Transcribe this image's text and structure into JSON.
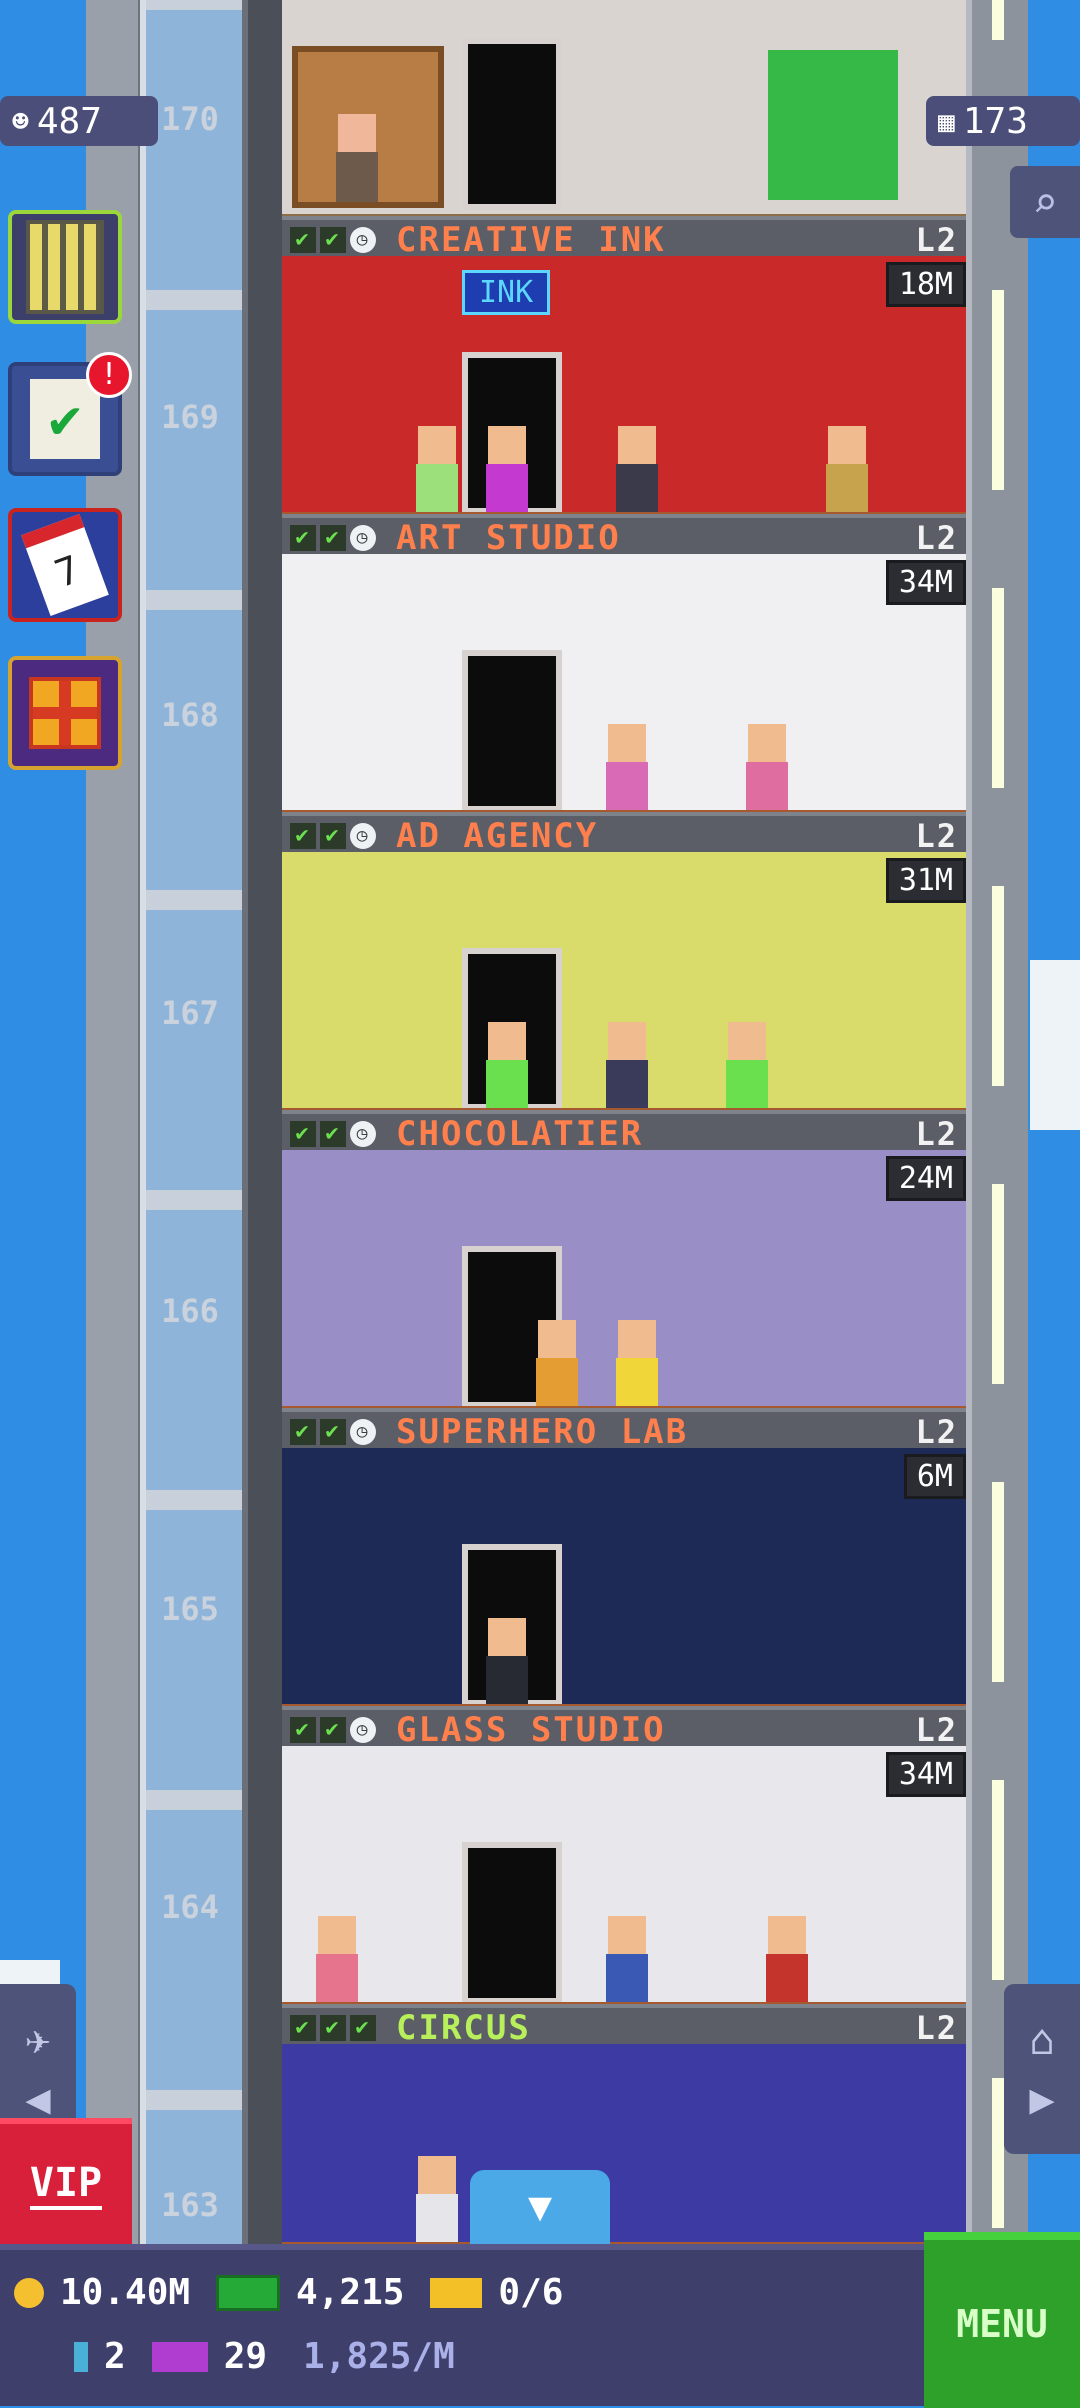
{
  "top_left_pill": {
    "icon": "person-icon",
    "value": "487"
  },
  "top_right_pill": {
    "icon": "building-icon",
    "value": "173"
  },
  "floor_numbers": [
    "170",
    "169",
    "168",
    "167",
    "166",
    "165",
    "164",
    "163"
  ],
  "floors": [
    {
      "name": "CREATIVE INK",
      "level": "L2",
      "timer": "18M",
      "sign": "INK",
      "wall": "#c92929"
    },
    {
      "name": "ART STUDIO",
      "level": "L2",
      "timer": "34M",
      "wall": "#f0f0f2"
    },
    {
      "name": "AD AGENCY",
      "level": "L2",
      "timer": "31M",
      "wall": "#d9dc6b"
    },
    {
      "name": "CHOCOLATIER",
      "level": "L2",
      "timer": "24M",
      "wall": "#9a8ec7"
    },
    {
      "name": "SUPERHERO LAB",
      "level": "L2",
      "timer": "6M",
      "wall": "#1c2a55"
    },
    {
      "name": "GLASS STUDIO",
      "level": "L2",
      "timer": "34M",
      "wall": "#e8e8ec"
    },
    {
      "name": "CIRCUS",
      "level": "L2",
      "timer": "",
      "wall": "#3d3aa3"
    }
  ],
  "side_buttons": [
    {
      "icon": "tower-icon"
    },
    {
      "icon": "checklist-icon",
      "badge": "!"
    },
    {
      "icon": "calendar-icon",
      "text": "7"
    },
    {
      "icon": "gift-icon"
    }
  ],
  "bottom_bar": {
    "coins": "10.40M",
    "bux": "4,215",
    "tickets": "0/6",
    "keys": "2",
    "gold": "29",
    "rate": "1,825/M"
  },
  "vip_label": "VIP",
  "menu_label": "MENU"
}
